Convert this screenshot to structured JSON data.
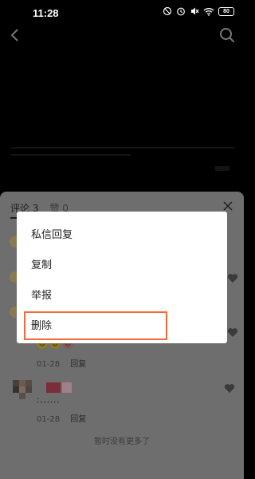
{
  "status_bar": {
    "time": "11:28",
    "battery": "80"
  },
  "comments": {
    "tab_comments": "评论 3",
    "tab_likes": "赞 0",
    "items": [
      {
        "date": "01-28",
        "reply": "回复"
      },
      {
        "date": "01-28",
        "reply": "回复",
        "text": ";,,,,,,"
      }
    ],
    "no_more": "暂时没有更多了"
  },
  "context_menu": {
    "items": [
      {
        "label": "私信回复"
      },
      {
        "label": "复制"
      },
      {
        "label": "举报"
      },
      {
        "label": "删除"
      }
    ]
  },
  "colors": {
    "highlight_border": "#f06a3a",
    "sheet_dimmed": "#6e6e6e"
  }
}
